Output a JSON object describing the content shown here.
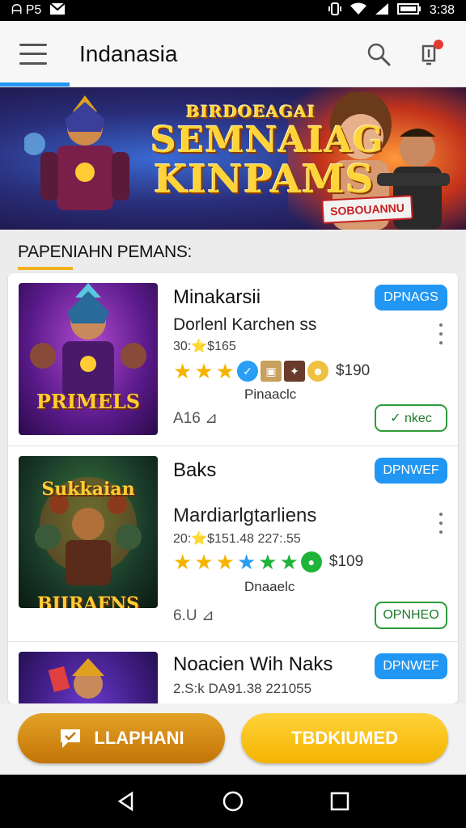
{
  "status_bar": {
    "left_text": "ᗩ P5",
    "time": "3:38"
  },
  "app_bar": {
    "title": "Indanasia"
  },
  "banner": {
    "subtitle": "BIRDOEAGAI",
    "title_line1": "SEMNAIAG",
    "title_line2": "KINPAMS",
    "badge": "SOBOUANNU"
  },
  "section": {
    "title": "PAPENIAHN PEMANS:"
  },
  "items": [
    {
      "name": "Minakarsii",
      "subtitle": "Dorlenl Karchen ss",
      "meta": "30:⭐$165",
      "rating_price": "$190",
      "caption": "Pinaaclc",
      "count": "A16 ⊿",
      "thumb_label": "PRIMELS",
      "primary_button": "DPNAGS",
      "secondary_button": "✓ nkec"
    },
    {
      "name": "Baks",
      "subtitle": "Mardiarlgtarliens",
      "meta": "20:⭐$151.48 227:.55",
      "rating_price": "$109",
      "caption": "Dnaaelc",
      "count": "6.U ⊿",
      "thumb_label": "BIIRAFNS",
      "thumb_label_top": "Sukkaian",
      "primary_button": "DPNWEF",
      "secondary_button": "OPNHEO"
    },
    {
      "name": "Noacien Wih Naks",
      "meta": "2.S:k DA91.38 221055",
      "primary_button": "DPNWEF"
    }
  ],
  "bottom": {
    "left_button": "LLAPHANI",
    "right_button": "TBDKIUMED"
  },
  "colors": {
    "accent_blue": "#2196f3",
    "accent_gold": "#f4b400",
    "accent_green": "#2e9b3a"
  }
}
